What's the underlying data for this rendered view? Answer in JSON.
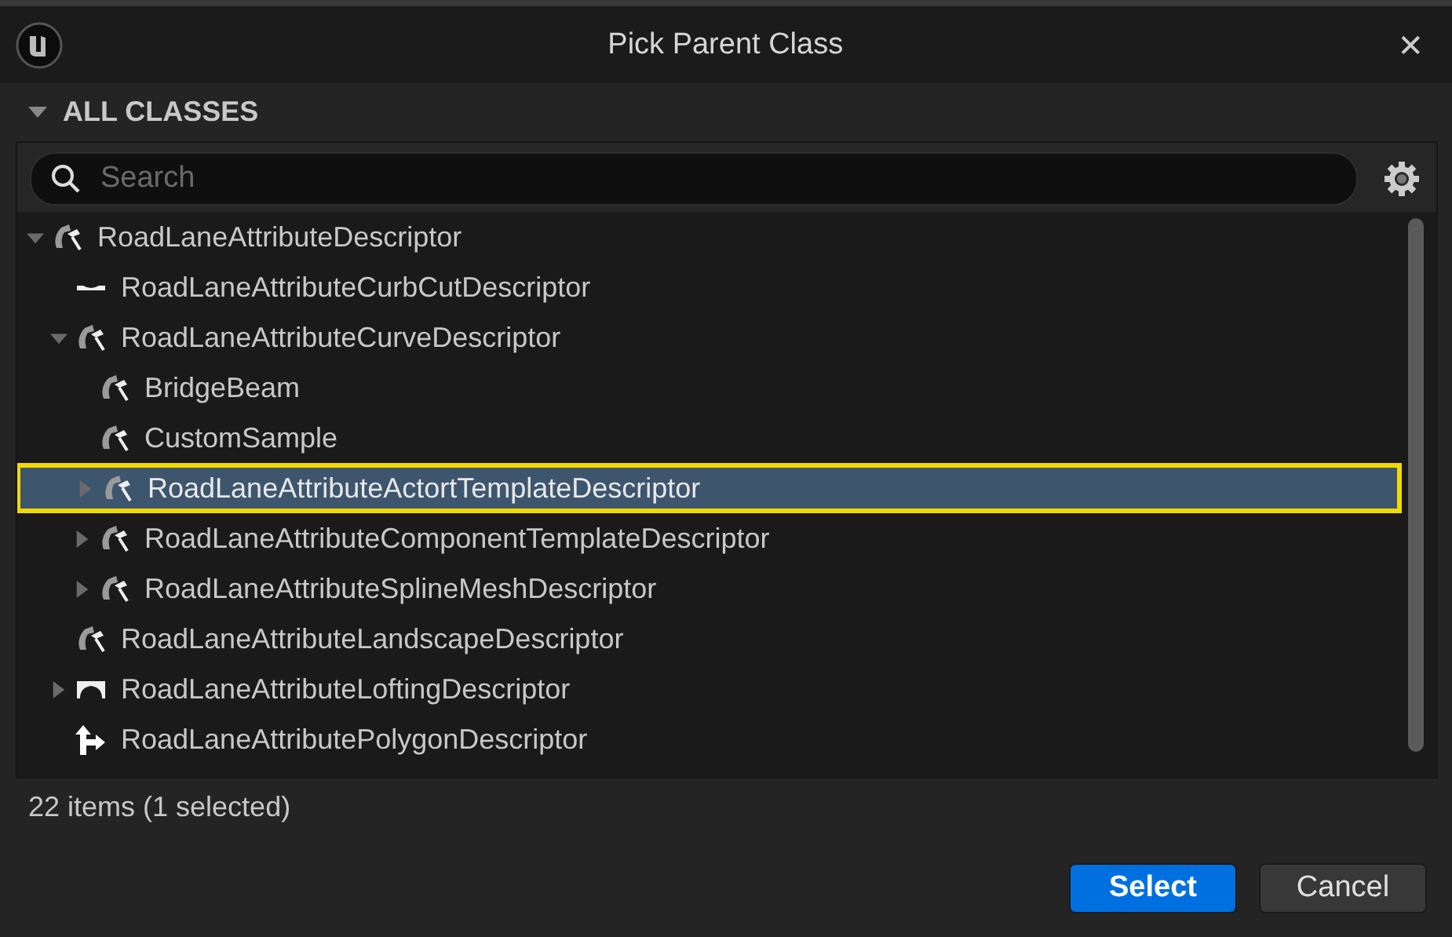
{
  "window": {
    "title": "Pick Parent Class",
    "close": "✕"
  },
  "section": {
    "title": "ALL CLASSES",
    "expanded": true
  },
  "search": {
    "placeholder": "Search"
  },
  "tree": [
    {
      "label": "RoadLaneAttributeDescriptor",
      "kind": "blueprint",
      "expanded": true,
      "selected": false,
      "children": [
        {
          "label": "RoadLaneAttributeCurbCutDescriptor",
          "kind": "curb",
          "selected": false
        },
        {
          "label": "RoadLaneAttributeCurveDescriptor",
          "kind": "blueprint",
          "expanded": true,
          "selected": false,
          "children": [
            {
              "label": "BridgeBeam",
              "kind": "blueprint",
              "selected": false
            },
            {
              "label": "CustomSample",
              "kind": "blueprint",
              "selected": false
            },
            {
              "label": "RoadLaneAttributeActortTemplateDescriptor",
              "kind": "blueprint",
              "expanded": false,
              "selected": true
            },
            {
              "label": "RoadLaneAttributeComponentTemplateDescriptor",
              "kind": "blueprint",
              "expanded": false,
              "selected": false
            },
            {
              "label": "RoadLaneAttributeSplineMeshDescriptor",
              "kind": "blueprint",
              "expanded": false,
              "selected": false
            }
          ]
        },
        {
          "label": "RoadLaneAttributeLandscapeDescriptor",
          "kind": "blueprint",
          "selected": false
        },
        {
          "label": "RoadLaneAttributeLoftingDescriptor",
          "kind": "loft",
          "expanded": false,
          "selected": false
        },
        {
          "label": "RoadLaneAttributePolygonDescriptor",
          "kind": "polygon",
          "selected": false
        }
      ]
    }
  ],
  "status": "22 items (1 selected)",
  "buttons": [
    {
      "label": "Select",
      "kind": "primary"
    },
    {
      "label": "Cancel",
      "kind": "secondary"
    }
  ]
}
